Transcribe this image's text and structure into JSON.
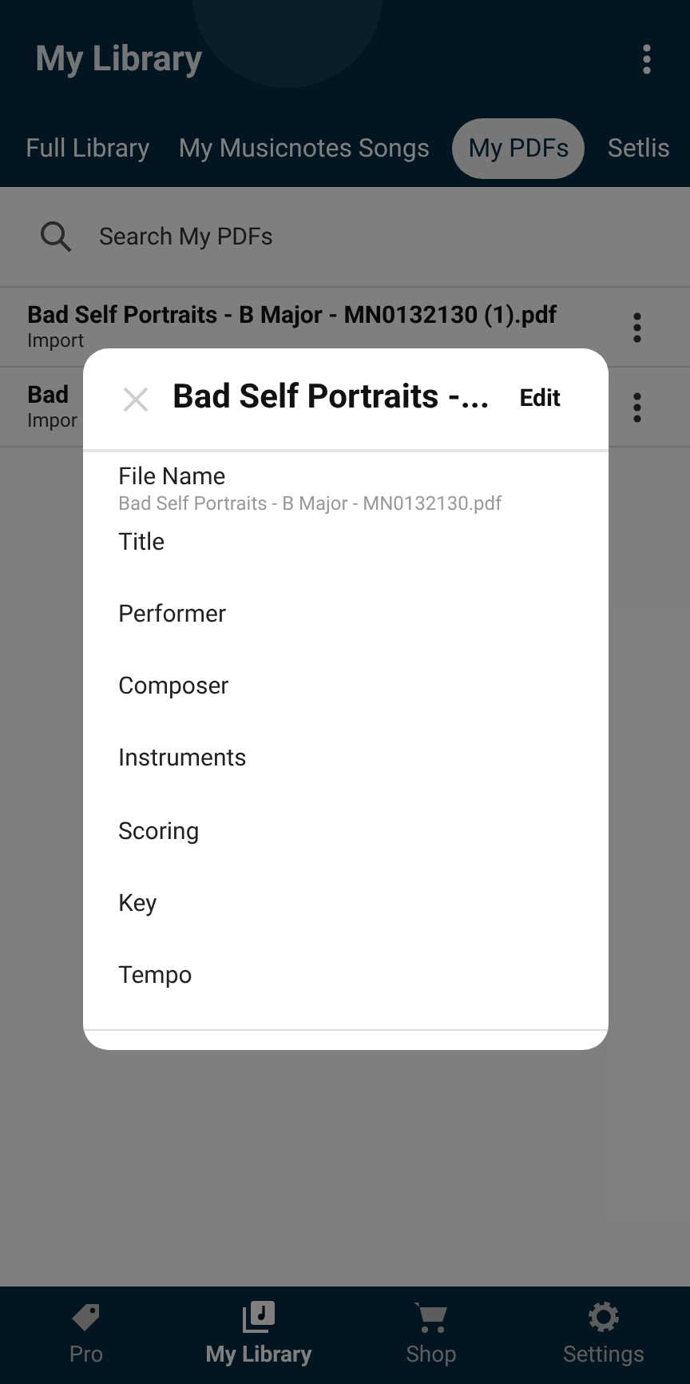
{
  "header": {
    "title": "My Library"
  },
  "tabs": [
    {
      "label": "Full Library",
      "selected": false
    },
    {
      "label": "My Musicnotes Songs",
      "selected": false
    },
    {
      "label": "My PDFs",
      "selected": true
    },
    {
      "label": "Setlis",
      "selected": false
    }
  ],
  "search": {
    "placeholder": "Search My PDFs"
  },
  "files": [
    {
      "name": "Bad Self Portraits - B Major - MN0132130 (1).pdf",
      "subtitle": "Import"
    },
    {
      "name": "Bad",
      "subtitle": "Impor"
    }
  ],
  "dialog": {
    "title": "Bad Self Portraits -...",
    "action": "Edit",
    "fields": [
      {
        "label": "File Name",
        "value": "Bad Self Portraits - B Major - MN0132130.pdf"
      },
      {
        "label": "Title"
      },
      {
        "label": "Performer"
      },
      {
        "label": "Composer"
      },
      {
        "label": "Instruments"
      },
      {
        "label": "Scoring"
      },
      {
        "label": "Key"
      },
      {
        "label": "Tempo"
      }
    ]
  },
  "bottom_nav": [
    {
      "label": "Pro",
      "selected": false
    },
    {
      "label": "My Library",
      "selected": true
    },
    {
      "label": "Shop",
      "selected": false
    },
    {
      "label": "Settings",
      "selected": false
    }
  ]
}
